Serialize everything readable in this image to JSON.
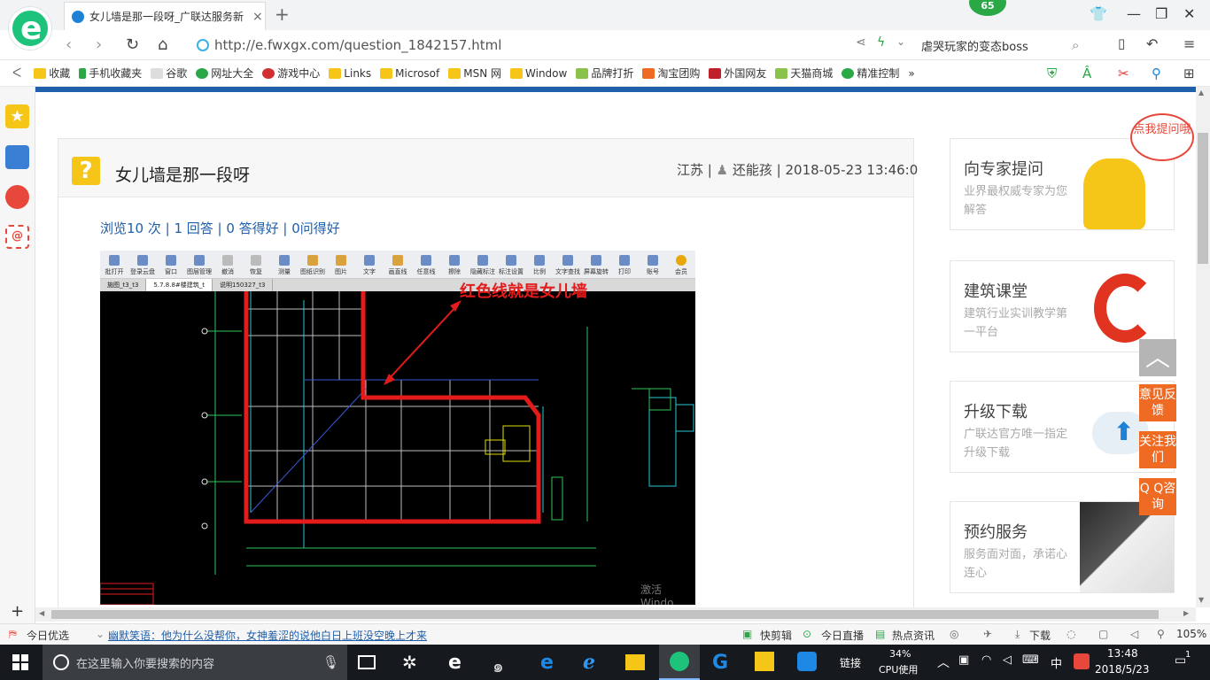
{
  "browser": {
    "tab_title": "女儿墙是那一段呀_广联达服务新",
    "badge": "65",
    "url": "http://e.fwxgx.com/question_1842157.html",
    "search_query": "虐哭玩家的变态boss"
  },
  "bookmarks": [
    "收藏",
    "手机收藏夹",
    "谷歌",
    "网址大全",
    "游戏中心",
    "Links",
    "Microsof",
    "MSN 网",
    "Window",
    "品牌打折",
    "淘宝团购",
    "外国网友",
    "天猫商城",
    "精准控制",
    "»"
  ],
  "question": {
    "title": "女儿墙是那一段呀",
    "region": "江苏",
    "author": "还能孩",
    "datetime": "2018-05-23 13:46:0",
    "stats": "浏览10 次 | 1 回答 | 0 答得好 | 0问得好"
  },
  "cad": {
    "toolbar": [
      "批打开",
      "登录云盘",
      "窗口",
      "图层管理",
      "撤消",
      "恢复",
      "测量",
      "图纸识别",
      "图片",
      "文字",
      "画直线",
      "任意线",
      "擦除",
      "隐藏标注",
      "标注设置",
      "比例",
      "文字查找",
      "屏幕旋转",
      "打印",
      "账号",
      "会员"
    ],
    "tabs": [
      "施图_t3_t3",
      "5.7.8.8#楼建筑_t",
      "说明150327_t3"
    ],
    "annotation": "红色线就是女儿墙",
    "watermark": "激活 Windo"
  },
  "sidebar": {
    "cards": [
      {
        "title": "向专家提问",
        "subtitle": "业界最权威专家为您解答"
      },
      {
        "title": "建筑课堂",
        "subtitle": "建筑行业实训教学第一平台"
      },
      {
        "title": "升级下载",
        "subtitle": "广联达官方唯一指定升级下载"
      },
      {
        "title": "预约服务",
        "subtitle": "服务面对面，承诺心连心"
      }
    ],
    "bubble": "点我提问哦"
  },
  "float_buttons": [
    "意见反馈",
    "关注我们",
    "Q Q咨询"
  ],
  "statusbar": {
    "today": "今日优选",
    "joke": "幽默笑语：他为什么没帮你，女神羞涩的说他白日上班没空晚上才来",
    "kuaijianji": "快剪辑",
    "live": "今日直播",
    "news": "热点资讯",
    "download": "下载",
    "zoom": "105%"
  },
  "taskbar": {
    "search_placeholder": "在这里输入你要搜索的内容",
    "link_label": "链接",
    "cpu_percent": "34%",
    "cpu_label": "CPU使用",
    "ime": "中",
    "time": "13:48",
    "date": "2018/5/23",
    "notif_count": "1"
  },
  "colors": {
    "brand_blue": "#1f5fab",
    "accent_orange": "#ef6a22",
    "annotation_red": "#e31b1b"
  }
}
